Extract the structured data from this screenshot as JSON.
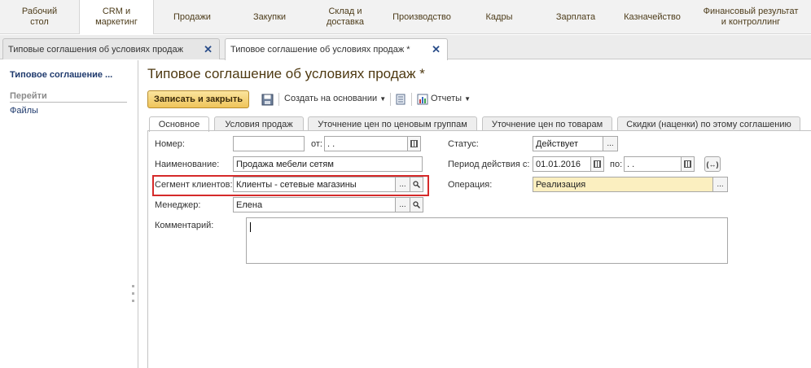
{
  "sections": [
    {
      "label": "Рабочий\nстол"
    },
    {
      "label": "CRM и\nмаркетинг"
    },
    {
      "label": "Продажи"
    },
    {
      "label": "Закупки"
    },
    {
      "label": "Склад и\nдоставка"
    },
    {
      "label": "Производство"
    },
    {
      "label": "Кадры"
    },
    {
      "label": "Зарплата"
    },
    {
      "label": "Казначейство"
    },
    {
      "label": "Финансовый результат\nи контроллинг"
    }
  ],
  "window_tabs": [
    {
      "label": "Типовые соглашения об условиях продаж"
    },
    {
      "label": "Типовое соглашение об условиях продаж *"
    }
  ],
  "left_panel": {
    "doc_title": "Типовое соглашение ...",
    "goto_label": "Перейти",
    "files_label": "Файлы"
  },
  "page_title": "Типовое соглашение об условиях продаж *",
  "toolbar": {
    "save_close_label": "Записать и закрыть",
    "create_based_label": "Создать на основании",
    "reports_label": "Отчеты"
  },
  "inner_tabs": [
    {
      "label": "Основное"
    },
    {
      "label": "Условия продаж"
    },
    {
      "label": "Уточнение цен по ценовым группам"
    },
    {
      "label": "Уточнение цен по товарам"
    },
    {
      "label": "Скидки (наценки) по этому соглашению"
    }
  ],
  "form": {
    "number_label": "Номер:",
    "number_value": "",
    "from_label": "от:",
    "from_value": " .  .",
    "name_label": "Наименование:",
    "name_value": "Продажа мебели сетям",
    "segment_label": "Сегмент клиентов:",
    "segment_value": "Клиенты - сетевые магазины",
    "manager_label": "Менеджер:",
    "manager_value": "Елена",
    "comment_label": "Комментарий:",
    "status_label": "Статус:",
    "status_value": "Действует",
    "period_label": "Период действия с:",
    "period_from": "01.01.2016",
    "period_to_label": "по:",
    "period_to": " .  .",
    "operation_label": "Операция:",
    "operation_value": "Реализация",
    "period_btn": "(↔)"
  }
}
